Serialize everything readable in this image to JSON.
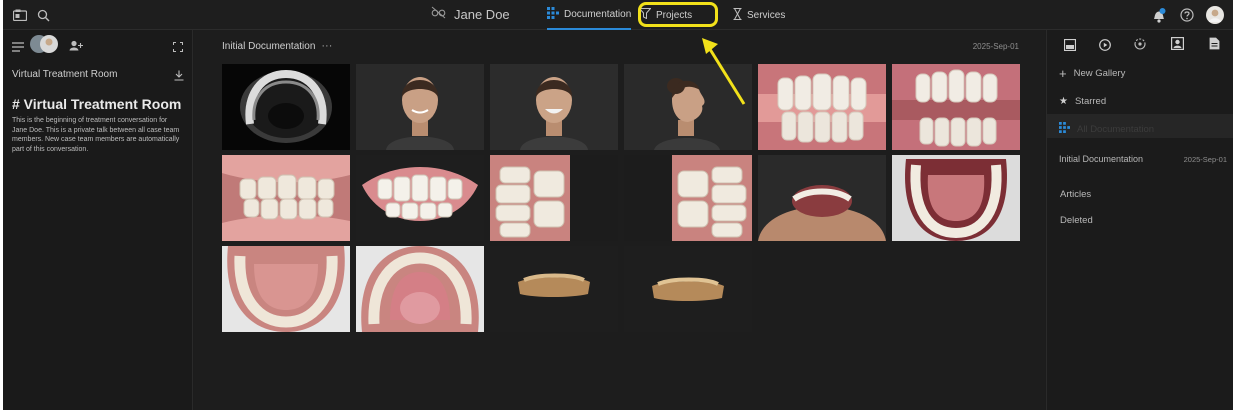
{
  "topbar": {
    "patient_name": "Jane Doe",
    "tabs": [
      {
        "label": "Documentation",
        "active": true
      },
      {
        "label": "Projects",
        "highlighted": true
      },
      {
        "label": "Services"
      }
    ],
    "notification_badge": "1"
  },
  "left_sidebar": {
    "room_title": "Virtual Treatment Room",
    "heading": "# Virtual Treatment Room",
    "description": "This is the beginning of treatment conversation for Jane Doe. This is a private talk between all case team members. New case team members are automatically part of this conversation."
  },
  "main": {
    "gallery_title": "Initial Documentation",
    "more_label": "···",
    "date": "2025-Sep-01",
    "thumbnails": [
      {
        "kind": "ct-scan"
      },
      {
        "kind": "face-front"
      },
      {
        "kind": "face-smile"
      },
      {
        "kind": "face-profile"
      },
      {
        "kind": "teeth-closeup"
      },
      {
        "kind": "teeth-closeup"
      },
      {
        "kind": "teeth-side"
      },
      {
        "kind": "teeth-smile"
      },
      {
        "kind": "teeth-side"
      },
      {
        "kind": "teeth-side"
      },
      {
        "kind": "face-tilt"
      },
      {
        "kind": "upper-arch"
      },
      {
        "kind": "upper-arch"
      },
      {
        "kind": "lower-arch"
      },
      {
        "kind": "scan-3d"
      },
      {
        "kind": "scan-3d"
      }
    ]
  },
  "right_sidebar": {
    "new_gallery": "New Gallery",
    "starred": "Starred",
    "all_documentation": "All Documentation",
    "gallery_item": {
      "label": "Initial Documentation",
      "date": "2025-Sep-01"
    },
    "articles": "Articles",
    "deleted": "Deleted"
  },
  "colors": {
    "accent": "#2b8ad8",
    "highlight": "#f2e11a",
    "background": "#1c1c1c"
  }
}
